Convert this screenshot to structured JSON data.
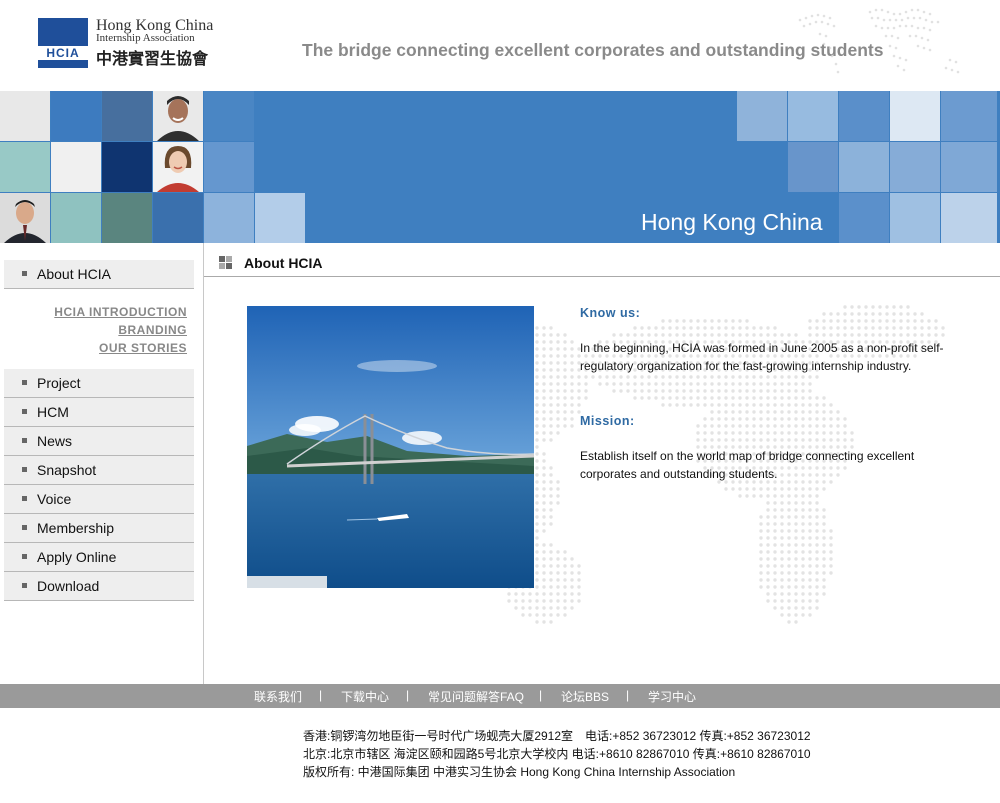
{
  "header": {
    "logo_box_text": "HCIA",
    "logo_en_line1": "Hong Kong China",
    "logo_en_line2": "Internship Association",
    "logo_cn": "中港實習生協會",
    "tagline": "The bridge connecting excellent corporates and outstanding students"
  },
  "banner": {
    "title": "Hong Kong China"
  },
  "sidebar": {
    "items": [
      {
        "label": "About HCIA"
      },
      {
        "label": "Project"
      },
      {
        "label": "HCM"
      },
      {
        "label": "News"
      },
      {
        "label": "Snapshot"
      },
      {
        "label": "Voice"
      },
      {
        "label": "Membership"
      },
      {
        "label": "Apply Online"
      },
      {
        "label": "Download"
      }
    ],
    "sublinks": [
      "HCIA INTRODUCTION",
      "BRANDING",
      "OUR STORIES"
    ]
  },
  "main": {
    "title": "About HCIA",
    "know_us_heading": "Know us:",
    "know_us_text": "In the beginning, HCIA was formed in June 2005 as a non-profit self-regulatory organization for the fast-growing internship industry.",
    "mission_heading": "Mission:",
    "mission_text": "Establish itself on the world map of bridge connecting excellent corporates and outstanding students."
  },
  "footer": {
    "links": [
      "联系我们",
      "下载中心",
      "常见问题解答FAQ",
      "论坛BBS",
      "学习中心"
    ],
    "separator": "|",
    "address_lines": [
      "香港:铜锣湾勿地臣街一号时代广场蚬壳大厦2912室　电话:+852 36723012  传真:+852 36723012",
      "北京:北京市辖区 海淀区颐和园路5号北京大学校内 电话:+8610 82867010 传真:+8610 82867010",
      "版权所有: 中港国际集团 中港实习生协会 Hong Kong China Internship Association"
    ]
  },
  "colors": {
    "brand_blue": "#1f4f9a",
    "banner_blue": "#3f7fc0",
    "heading_blue": "#2f6aa3",
    "footer_gray": "#9a9a9a"
  }
}
